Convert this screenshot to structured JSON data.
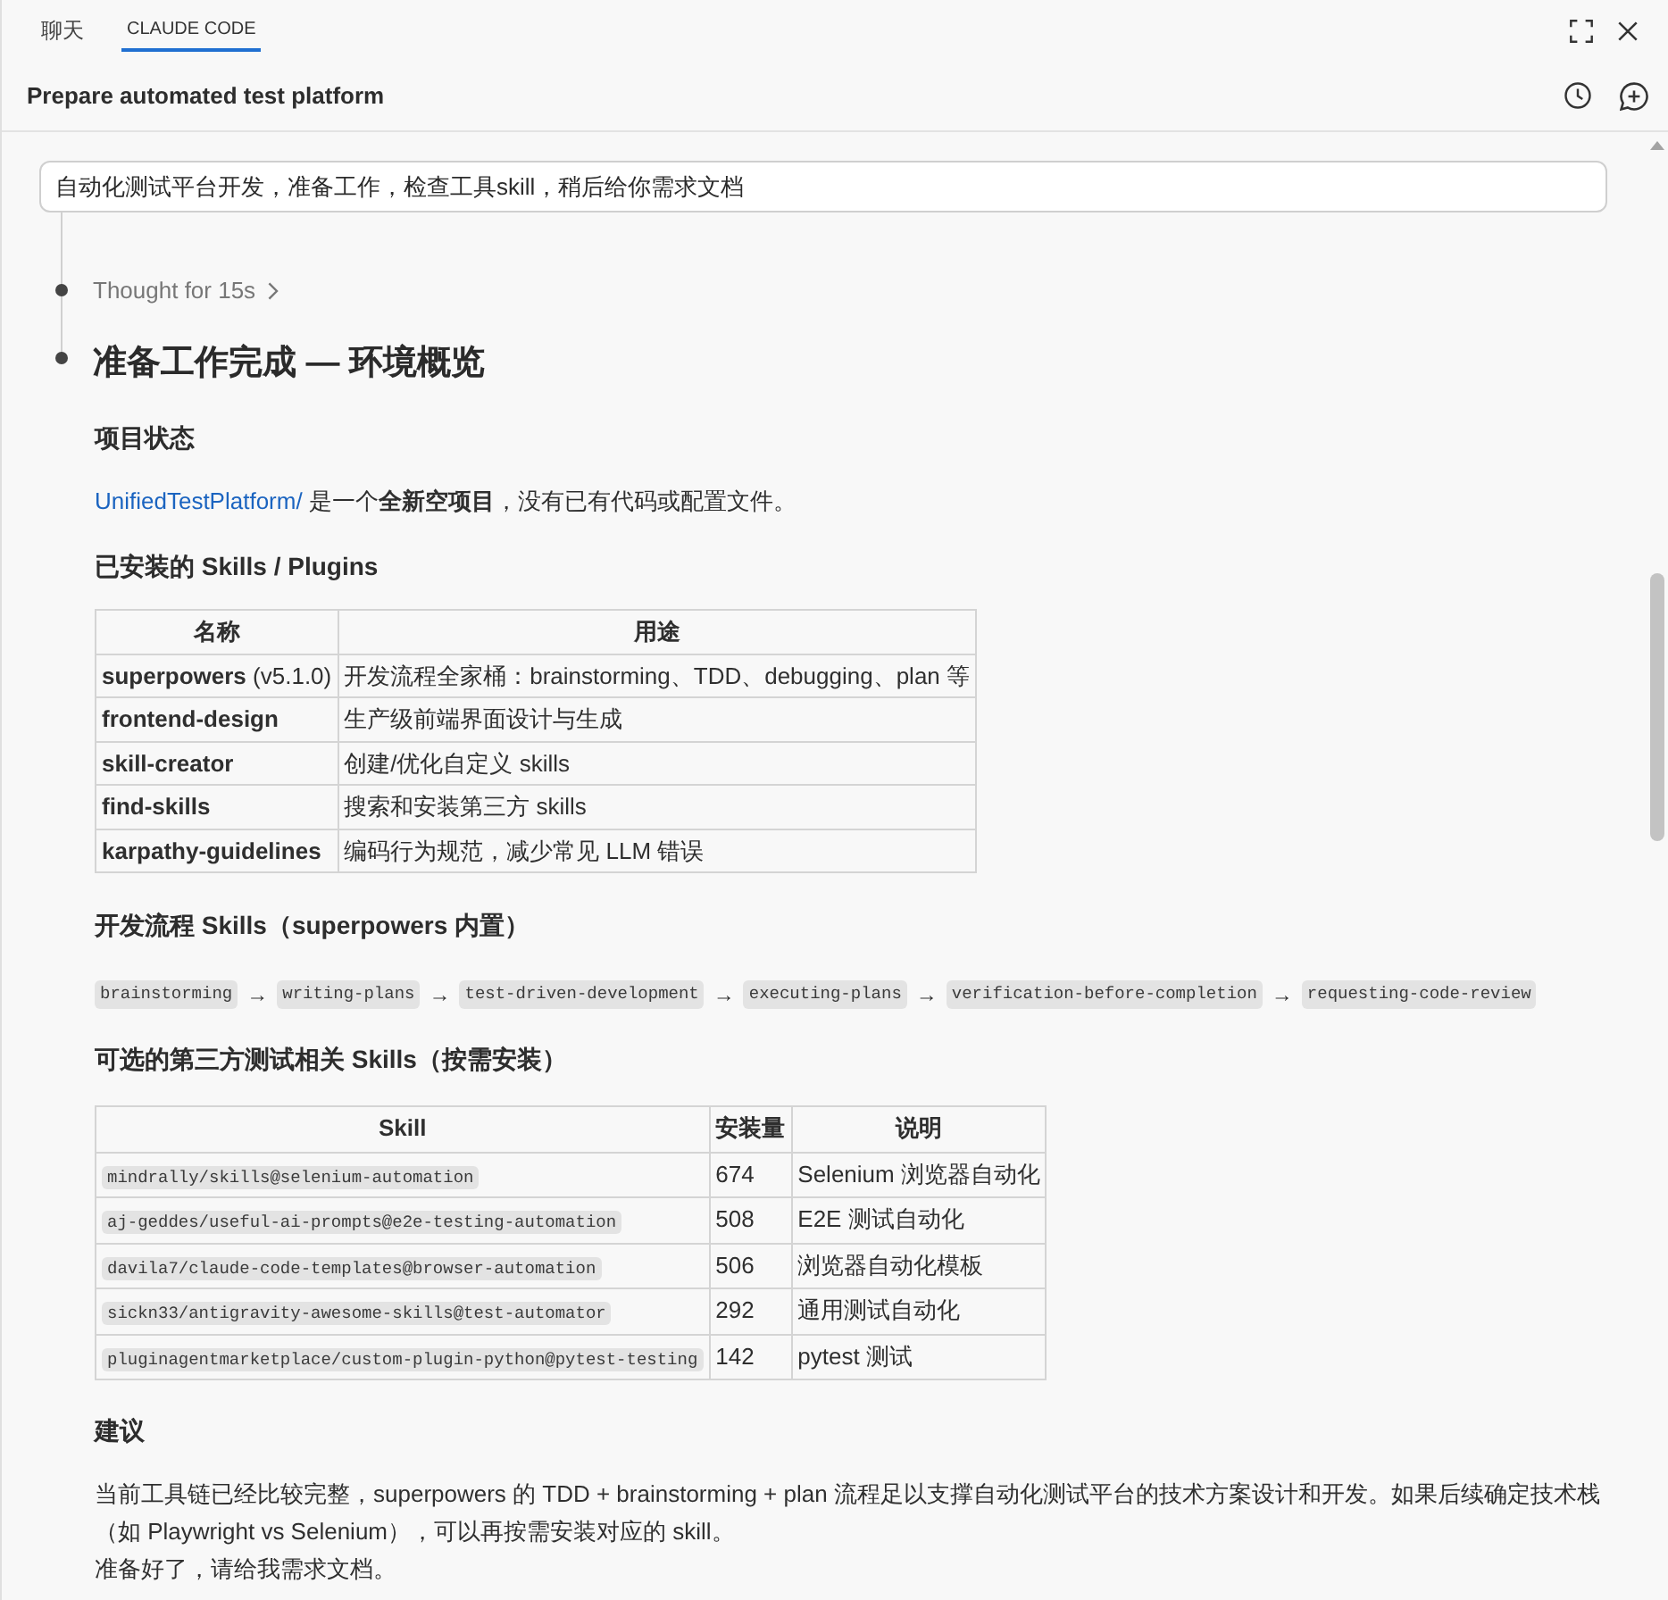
{
  "tabs": [
    {
      "label": "聊天",
      "selected": false
    },
    {
      "label": "CLAUDE CODE",
      "selected": true
    }
  ],
  "header": {
    "title": "Prepare automated test platform"
  },
  "user_message": "自动化测试平台开发，准备工作，检查工具skill，稍后给你需求文档",
  "thought": {
    "label": "Thought for 15s",
    "expanded": false
  },
  "response": {
    "title": "准备工作完成 — 环境概览",
    "blocks": [
      {
        "kind": "heading",
        "text": "项目状态"
      },
      {
        "kind": "paragraph",
        "link": "UnifiedTestPlatform/",
        "lines": [
          "是一个**全新空项目**，没有已有代码或配置文件。"
        ]
      },
      {
        "kind": "heading",
        "text": "已安装的 Skills / Plugins"
      },
      {
        "kind": "skills_table",
        "columns": [
          "名称",
          "用途"
        ],
        "rows": [
          {
            "name": "superpowers",
            "version": "(v5.1.0)",
            "purpose": "开发流程全家桶：brainstorming、TDD、debugging、plan 等"
          },
          {
            "name": "frontend-design",
            "purpose": "生产级前端界面设计与生成"
          },
          {
            "name": "skill-creator",
            "purpose": "创建/优化自定义 skills"
          },
          {
            "name": "find-skills",
            "purpose": "搜索和安装第三方 skills"
          },
          {
            "name": "karpathy-guidelines",
            "purpose": "编码行为规范，减少常见 LLM 错误"
          }
        ]
      },
      {
        "kind": "heading",
        "text": "开发流程 Skills（superpowers 内置）"
      },
      {
        "kind": "flow",
        "items": [
          {
            "kind": "code",
            "text": "brainstorming"
          },
          {
            "kind": "arrow",
            "text": "→"
          },
          {
            "kind": "code",
            "text": "writing-plans"
          },
          {
            "kind": "arrow",
            "text": "→"
          },
          {
            "kind": "code",
            "text": "test-driven-development"
          },
          {
            "kind": "arrow",
            "text": "→"
          },
          {
            "kind": "code",
            "text": "executing-plans"
          },
          {
            "kind": "arrow",
            "text": "→"
          },
          {
            "kind": "code",
            "text": "verification-before-completion"
          },
          {
            "kind": "arrow",
            "text": "→"
          },
          {
            "kind": "code",
            "text": "requesting-code-review"
          }
        ]
      },
      {
        "kind": "heading",
        "text": "可选的第三方测试相关 Skills（按需安装）"
      },
      {
        "kind": "install_table",
        "columns": [
          "Skill",
          "安装量",
          "说明"
        ],
        "rows": [
          {
            "skill": "mindrally/skills@selenium-automation",
            "installs": "674",
            "description": "Selenium 浏览器自动化"
          },
          {
            "skill": "aj-geddes/useful-ai-prompts@e2e-testing-automation",
            "installs": "508",
            "description": "E2E 测试自动化"
          },
          {
            "skill": "davila7/claude-code-templates@browser-automation",
            "installs": "506",
            "description": "浏览器自动化模板"
          },
          {
            "skill": "sickn33/antigravity-awesome-skills@test-automator",
            "installs": "292",
            "description": "通用测试自动化"
          },
          {
            "skill": "pluginagentmarketplace/custom-plugin-python@pytest-testing",
            "installs": "142",
            "description": "pytest 测试"
          }
        ]
      },
      {
        "kind": "heading",
        "text": "建议"
      },
      {
        "kind": "paragraph",
        "lines": [
          "当前工具链已经比较完整，superpowers 的 TDD + brainstorming + plan 流程足以支撑自动化测试平台的技术方案设计和开发。如果后续确定技术栈（如 Playwright vs Selenium），可以再按需安装对应的 skill。",
          "准备好了，请给我需求文档。"
        ]
      }
    ]
  }
}
